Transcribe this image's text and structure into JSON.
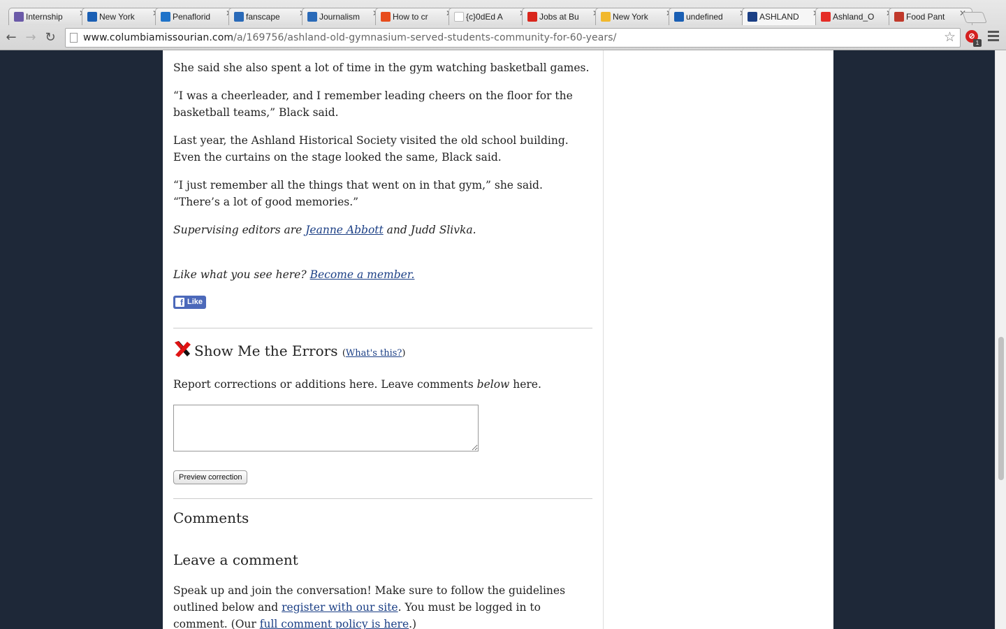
{
  "browser": {
    "tabs": [
      {
        "title": "Internship",
        "favicon": "paw-icon",
        "color": "#6b5aa8"
      },
      {
        "title": "New York",
        "favicon": "vimeo-v-icon",
        "color": "#1a5fb4"
      },
      {
        "title": "Penaflorid",
        "favicon": "outlook-icon",
        "color": "#1f73c9"
      },
      {
        "title": "fanscape",
        "favicon": "linkedin-icon",
        "color": "#2a6ab8"
      },
      {
        "title": "Journalism",
        "favicon": "linkedin-icon",
        "color": "#2a6ab8"
      },
      {
        "title": "How to cr",
        "favicon": "windows-icon",
        "color": "#e74c1c"
      },
      {
        "title": "{c}0dEd A",
        "favicon": "blank-page-icon",
        "color": "#ffffff"
      },
      {
        "title": "Jobs at Bu",
        "favicon": "buzzfeed-icon",
        "color": "#d9261c"
      },
      {
        "title": "New York",
        "favicon": "mizzou-icon",
        "color": "#f1b82d"
      },
      {
        "title": "undefined",
        "favicon": "vimeo-v-icon",
        "color": "#1a5fb4"
      },
      {
        "title": "ASHLAND",
        "favicon": "missourian-m-icon",
        "color": "#1b3f85"
      },
      {
        "title": "Ashland_O",
        "favicon": "youtube-icon",
        "color": "#e52d27"
      },
      {
        "title": "Food Pant",
        "favicon": "pantry-icon",
        "color": "#c0392b"
      }
    ],
    "active_tab": 10,
    "url": {
      "host": "www.columbiamissourian.com",
      "path": "/a/169756/ashland-old-gymnasium-served-students-community-for-60-years/"
    },
    "extension_badge": "1"
  },
  "article": {
    "paragraphs": [
      "She said she also spent a lot of time in the gym watching basketball games.",
      "“I was a cheerleader, and I remember leading cheers on the floor for the basketball teams,” Black said.",
      "Last year, the Ashland Historical Society visited the old school building. Even the curtains on the stage looked the same, Black said.",
      "“I just remember all the things that went on in that gym,” she said. “There’s a lot of good memories.”"
    ],
    "editors": {
      "prefix": "Supervising editors are ",
      "link": "Jeanne Abbott",
      "suffix": " and Judd Slivka."
    },
    "membership": {
      "text": "Like what you see here? ",
      "link": "Become a member."
    },
    "fb_like": "Like"
  },
  "errors_section": {
    "title": "Show Me the Errors",
    "whats_this": "What's this?",
    "description_before": "Report corrections or additions here. Leave comments ",
    "description_em": "below",
    "description_after": " here.",
    "textarea_value": "",
    "preview_button": "Preview correction"
  },
  "comments": {
    "heading": "Comments",
    "leave_heading": "Leave a comment",
    "text1": "Speak up and join the conversation! Make sure to follow the guidelines outlined below and ",
    "register_link": "register with our site",
    "text2": ". You must be logged in to comment. (Our ",
    "policy_link": "full comment policy is here",
    "text3": ".)"
  }
}
